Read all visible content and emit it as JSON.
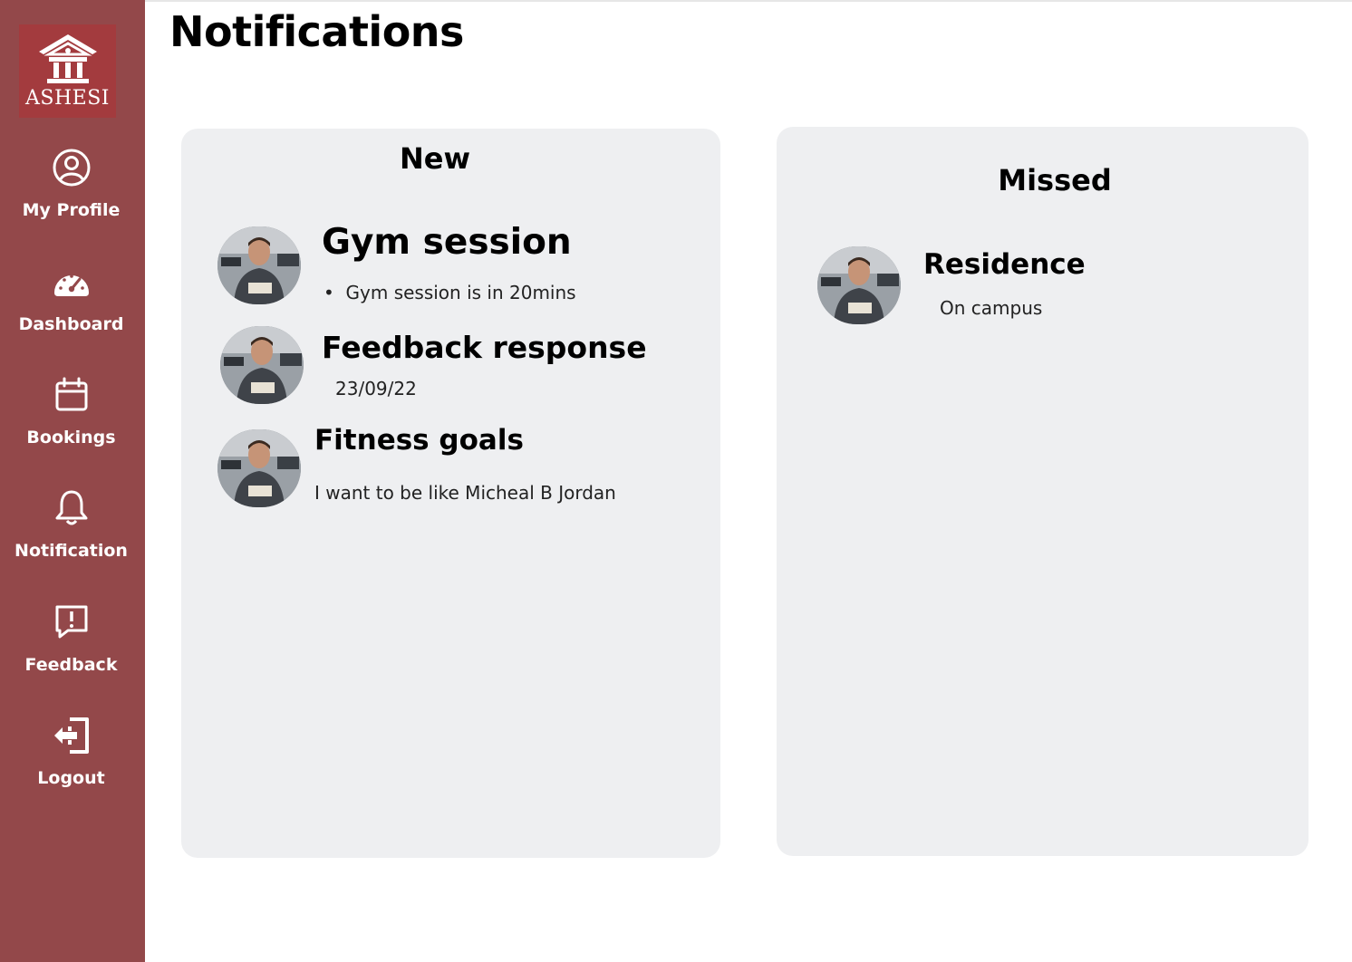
{
  "app": {
    "logo_text": "ASHESI",
    "brand_color": "#93484a",
    "logo_bg": "#a33b3e"
  },
  "sidebar": {
    "items": [
      {
        "label": "My Profile",
        "icon": "user-circle-icon"
      },
      {
        "label": "Dashboard",
        "icon": "speedometer-icon"
      },
      {
        "label": "Bookings",
        "icon": "calendar-icon"
      },
      {
        "label": "Notification",
        "icon": "bell-icon"
      },
      {
        "label": "Feedback",
        "icon": "alert-message-icon"
      },
      {
        "label": "Logout",
        "icon": "logout-icon"
      }
    ]
  },
  "page": {
    "title": "Notifications"
  },
  "new_panel": {
    "title": "New",
    "items": [
      {
        "title": "Gym session",
        "subtitle": "Gym session is in 20mins",
        "bullet": "•"
      },
      {
        "title": "Feedback response",
        "subtitle": "23/09/22"
      },
      {
        "title": "Fitness goals",
        "subtitle": "I want to be like Micheal B Jordan"
      }
    ]
  },
  "missed_panel": {
    "title": "Missed",
    "items": [
      {
        "title": "Residence",
        "subtitle": "On campus"
      }
    ]
  }
}
